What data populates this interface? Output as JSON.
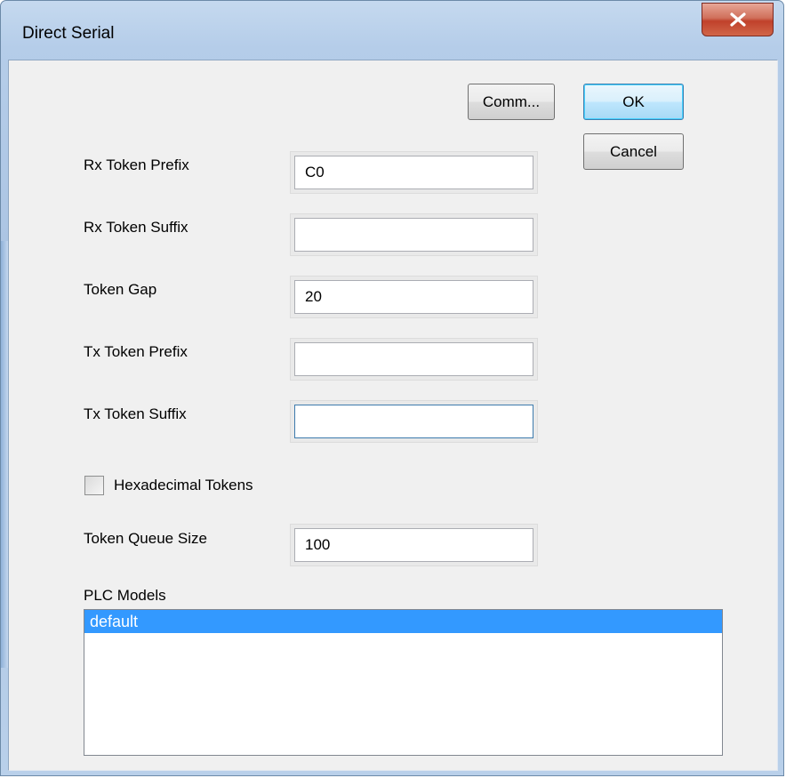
{
  "window": {
    "title": "Direct Serial"
  },
  "buttons": {
    "comm": "Comm...",
    "ok": "OK",
    "cancel": "Cancel"
  },
  "fields": {
    "rx_token_prefix": {
      "label": "Rx Token Prefix",
      "value": "C0"
    },
    "rx_token_suffix": {
      "label": "Rx Token Suffix",
      "value": ""
    },
    "token_gap": {
      "label": "Token Gap",
      "value": "20"
    },
    "tx_token_prefix": {
      "label": "Tx Token Prefix",
      "value": ""
    },
    "tx_token_suffix": {
      "label": "Tx Token Suffix",
      "value": ""
    },
    "token_queue_size": {
      "label": "Token Queue Size",
      "value": "100"
    }
  },
  "hex_tokens": {
    "label": "Hexadecimal Tokens",
    "checked": false
  },
  "plc_models": {
    "label": "PLC Models",
    "items": [
      "default"
    ],
    "selected": "default"
  },
  "colors": {
    "selection": "#3399ff",
    "close_button": "#c0412b",
    "dialog_bg": "#f0f0f0"
  },
  "icons": {
    "close": "close-icon"
  }
}
